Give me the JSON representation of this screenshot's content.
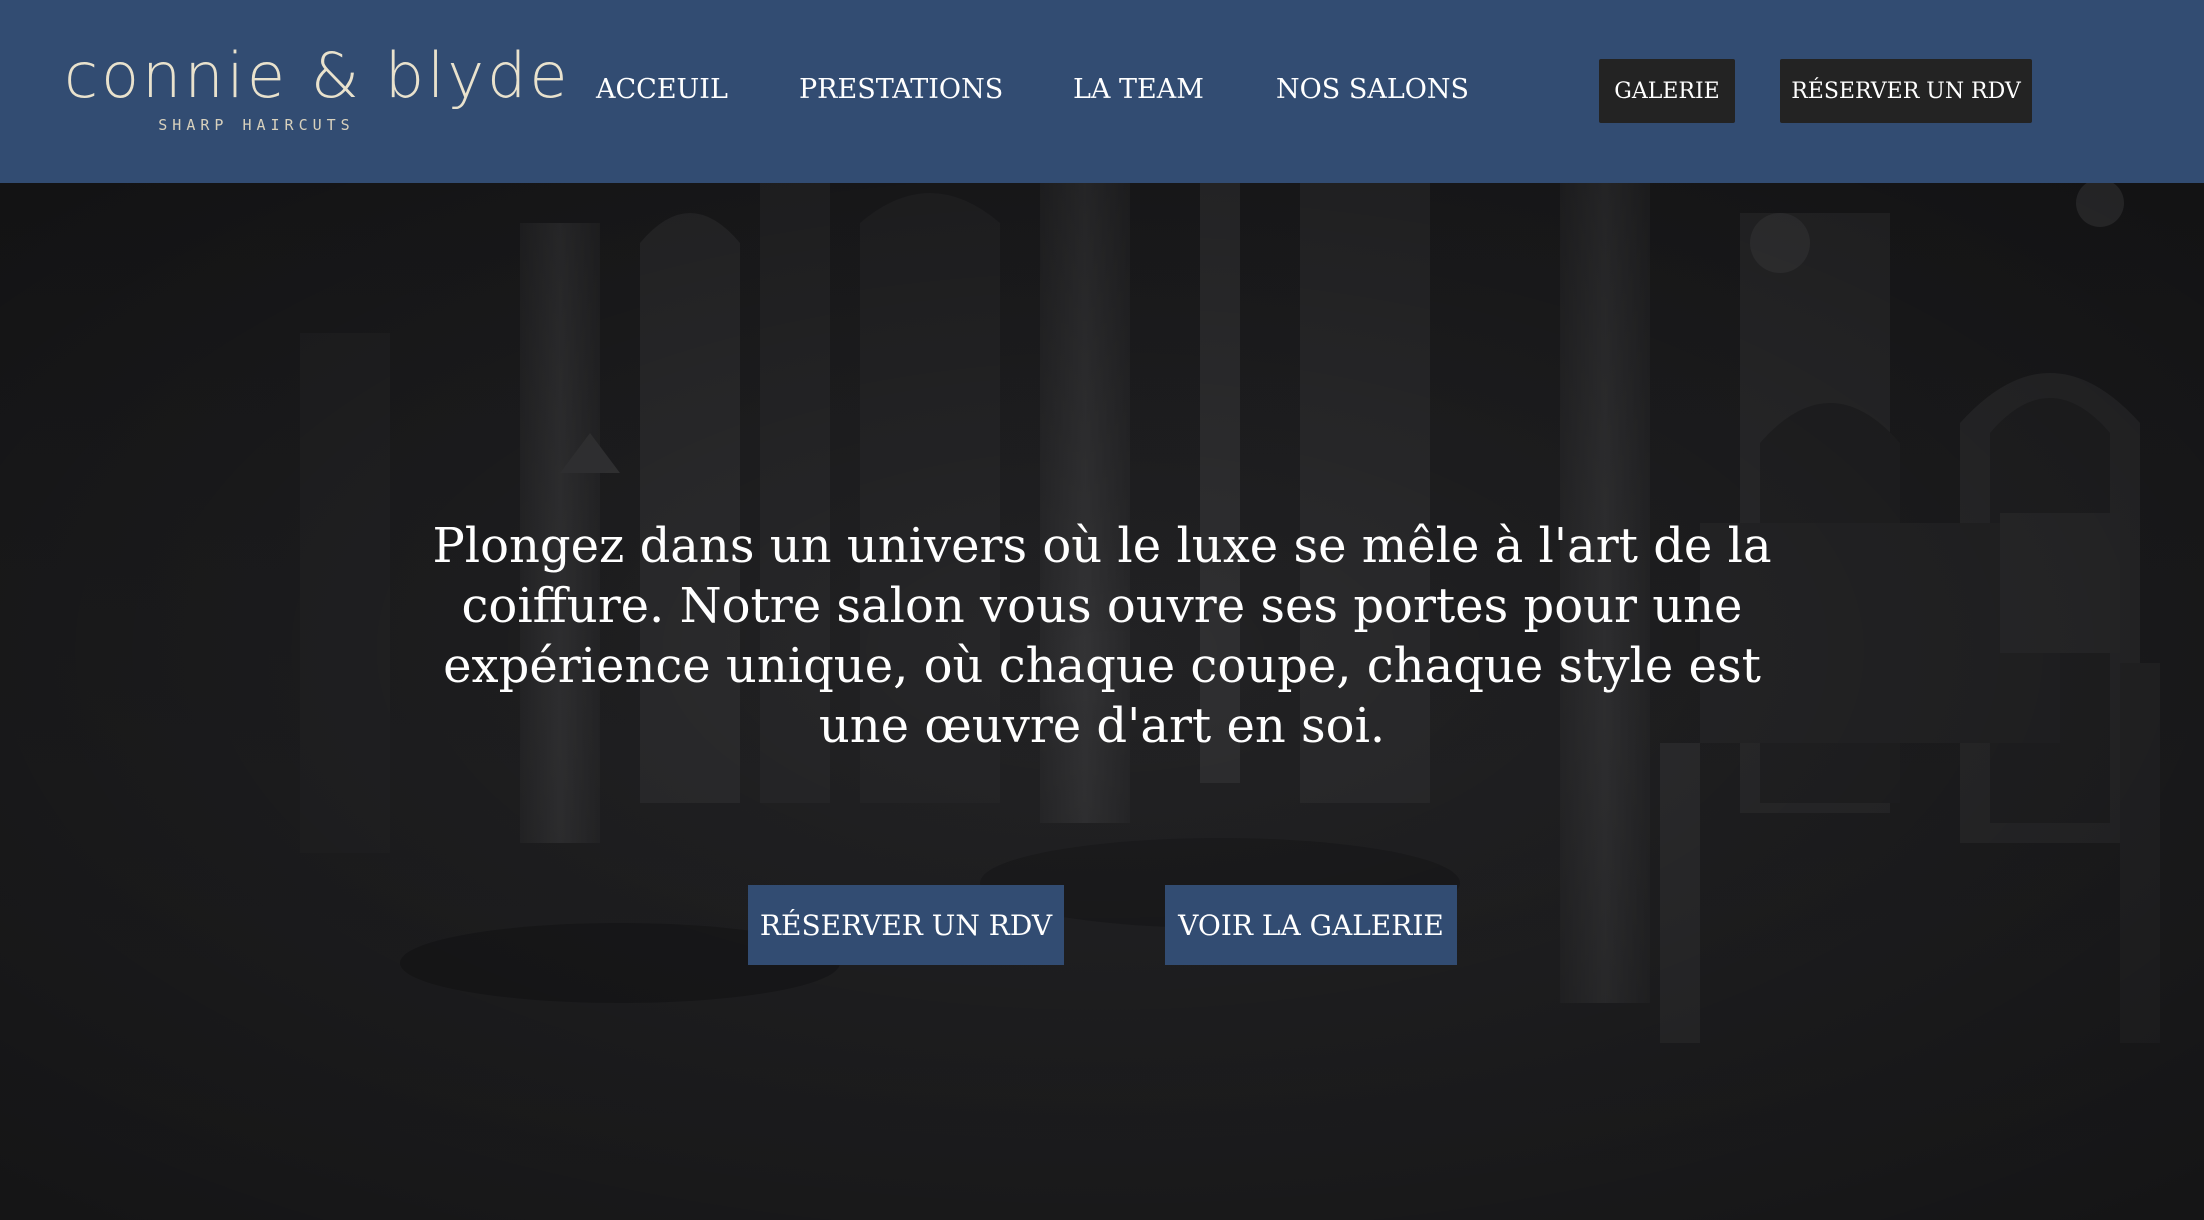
{
  "brand": {
    "name": "connie & blyde",
    "tagline": "SHARP HAIRCUTS"
  },
  "nav": {
    "items": [
      {
        "label": "ACCEUIL"
      },
      {
        "label": "PRESTATIONS"
      },
      {
        "label": "LA TEAM"
      },
      {
        "label": "NOS SALONS"
      }
    ],
    "galerie_button": "GALERIE",
    "reserve_button": "RÉSERVER UN RDV"
  },
  "hero": {
    "background_icon": "salon-interior-image",
    "text": "Plongez dans un univers où le luxe se mêle à l'art de la coiffure. Notre salon vous ouvre ses portes pour une expérience unique, où chaque coupe, chaque style est une œuvre d'art en soi.",
    "reserve_button": "RÉSERVER UN RDV",
    "gallery_button": "VOIR LA GALERIE"
  },
  "colors": {
    "header_bg": "#324c72",
    "logo": "#e9e2cd",
    "dark_button": "#232323",
    "hero_button": "#324c72",
    "hero_bg": "#222224"
  }
}
